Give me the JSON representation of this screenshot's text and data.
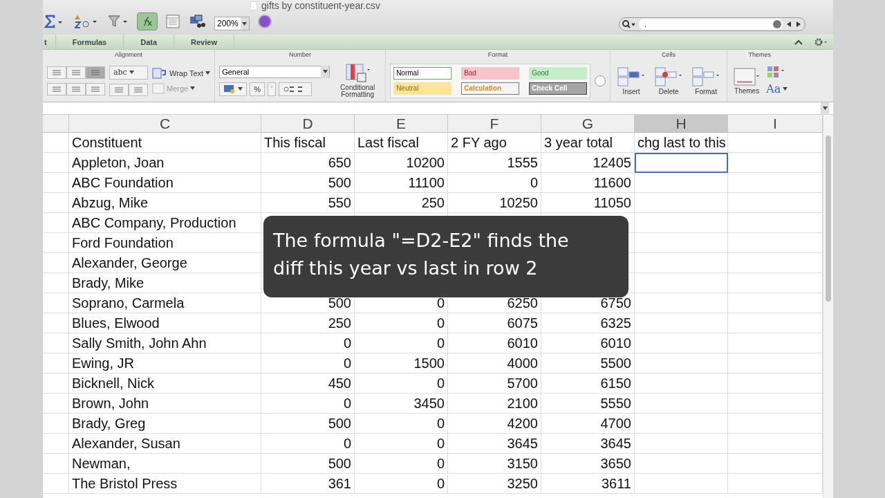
{
  "window": {
    "title": "gifts by constituent-year.csv"
  },
  "toolbar": {
    "zoom": "200%",
    "search": {
      "value": "."
    }
  },
  "tabs": [
    {
      "label": "t",
      "selected": false
    },
    {
      "label": "Formulas",
      "selected": false
    },
    {
      "label": "Data",
      "selected": false
    },
    {
      "label": "Review",
      "selected": false
    }
  ],
  "ribbon": {
    "alignment": {
      "title": "Alignment",
      "orientation": "abc",
      "wrap": "Wrap Text",
      "merge": "Merge"
    },
    "number": {
      "title": "Number",
      "format": "General",
      "percent": "%",
      "comma": "͗",
      "conditional": "Conditional Formatting"
    },
    "format": {
      "title": "Format",
      "styles": [
        {
          "label": "Normal",
          "kind": "normal"
        },
        {
          "label": "Bad",
          "kind": "bad"
        },
        {
          "label": "Good",
          "kind": "good"
        },
        {
          "label": "Neutral",
          "kind": "neutral"
        },
        {
          "label": "Calculation",
          "kind": "calculation"
        },
        {
          "label": "Check Cell",
          "kind": "check"
        }
      ]
    },
    "cells": {
      "title": "Cells",
      "buttons": [
        "Insert",
        "Delete",
        "Format"
      ]
    },
    "themes": {
      "title": "Themes",
      "button": "Themes",
      "fonts": "Aa"
    }
  },
  "sheet": {
    "columns": [
      {
        "label": "C",
        "selected": false
      },
      {
        "label": "D",
        "selected": false
      },
      {
        "label": "E",
        "selected": false
      },
      {
        "label": "F",
        "selected": false
      },
      {
        "label": "G",
        "selected": false
      },
      {
        "label": "H",
        "selected": true
      },
      {
        "label": "I",
        "selected": false
      }
    ],
    "header_row": [
      "Constituent",
      "This fiscal",
      "Last fiscal",
      "2 FY ago",
      "3 year total",
      "chg last to this"
    ],
    "rows": [
      {
        "name": "Appleton, Joan",
        "values": [
          "650",
          "10200",
          "1555",
          "12405"
        ],
        "active": true
      },
      {
        "name": "ABC Foundation",
        "values": [
          "500",
          "11100",
          "0",
          "11600"
        ],
        "active": false
      },
      {
        "name": "Abzug, Mike",
        "values": [
          "550",
          "250",
          "10250",
          "11050"
        ],
        "active": false
      },
      {
        "name": "ABC Company, Production",
        "active": false
      },
      {
        "name": "Ford Foundation",
        "active": false
      },
      {
        "name": "Alexander, George",
        "active": false
      },
      {
        "name": "Brady, Mike",
        "active": false
      },
      {
        "name": "Soprano, Carmela",
        "values": [
          "500",
          "0",
          "6250",
          "6750"
        ],
        "active": false
      },
      {
        "name": "Blues, Elwood",
        "values": [
          "250",
          "0",
          "6075",
          "6325"
        ],
        "active": false
      },
      {
        "name": "Sally Smith, John Ahn",
        "values": [
          "0",
          "0",
          "6010",
          "6010"
        ],
        "active": false
      },
      {
        "name": "Ewing, JR",
        "values": [
          "0",
          "1500",
          "4000",
          "5500"
        ],
        "active": false
      },
      {
        "name": "Bicknell, Nick",
        "values": [
          "450",
          "0",
          "5700",
          "6150"
        ],
        "active": false
      },
      {
        "name": "Brown, John",
        "values": [
          "0",
          "3450",
          "2100",
          "5550"
        ],
        "active": false
      },
      {
        "name": "Brady, Greg",
        "values": [
          "500",
          "0",
          "4200",
          "4700"
        ],
        "active": false
      },
      {
        "name": "Alexander, Susan",
        "values": [
          "0",
          "0",
          "3645",
          "3645"
        ],
        "active": false
      },
      {
        "name": "Newman,",
        "values": [
          "500",
          "0",
          "3150",
          "3650"
        ],
        "active": false
      },
      {
        "name": "The Bristol Press",
        "values": [
          "361",
          "0",
          "3250",
          "3611"
        ],
        "active": false
      }
    ]
  },
  "caption": {
    "text": "The formula \"=D2-E2\" finds the diff this year vs last in row 2"
  }
}
